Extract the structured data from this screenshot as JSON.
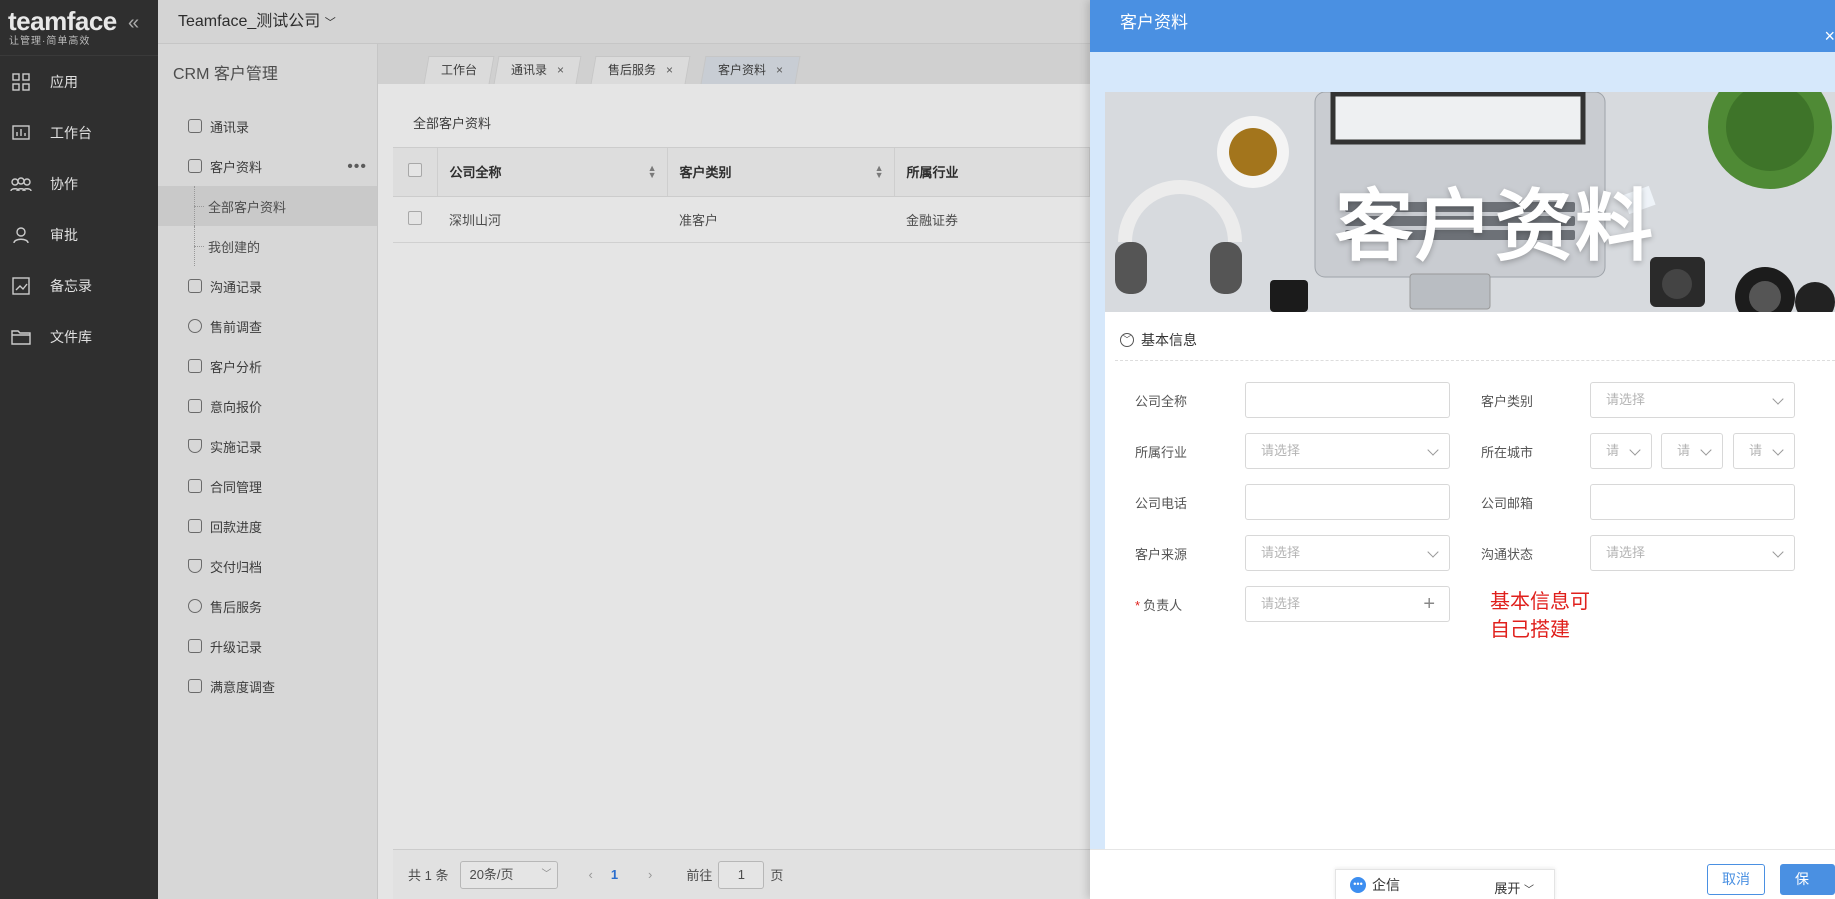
{
  "app": {
    "brand": "teamface",
    "slogan": "让管理·简单高效",
    "company": "Teamface_测试公司"
  },
  "nav": {
    "items": [
      {
        "label": "应用",
        "icon": "grid-icon"
      },
      {
        "label": "工作台",
        "icon": "chart-icon"
      },
      {
        "label": "协作",
        "icon": "people-icon"
      },
      {
        "label": "审批",
        "icon": "user-icon"
      },
      {
        "label": "备忘录",
        "icon": "memo-icon"
      },
      {
        "label": "文件库",
        "icon": "folder-icon"
      }
    ]
  },
  "crm": {
    "title": "CRM 客户管理",
    "items": [
      {
        "label": "通讯录"
      },
      {
        "label": "客户资料"
      },
      {
        "label": "全部客户资料"
      },
      {
        "label": "我创建的"
      },
      {
        "label": "沟通记录"
      },
      {
        "label": "售前调查"
      },
      {
        "label": "客户分析"
      },
      {
        "label": "意向报价"
      },
      {
        "label": "实施记录"
      },
      {
        "label": "合同管理"
      },
      {
        "label": "回款进度"
      },
      {
        "label": "交付归档"
      },
      {
        "label": "售后服务"
      },
      {
        "label": "升级记录"
      },
      {
        "label": "满意度调查"
      }
    ]
  },
  "tabs": [
    {
      "label": "工作台"
    },
    {
      "label": "通讯录"
    },
    {
      "label": "售后服务"
    },
    {
      "label": "客户资料"
    }
  ],
  "list": {
    "title": "全部客户资料",
    "columns": [
      "公司全称",
      "客户类别",
      "所属行业"
    ],
    "rows": [
      [
        "深圳山河",
        "准客户",
        "金融证券"
      ]
    ],
    "pager": {
      "total": "共 1 条",
      "size": "20条/页",
      "page": "1",
      "goto": "前往",
      "goto_value": "1",
      "unit": "页"
    }
  },
  "drawer": {
    "title": "客户资料",
    "close": "×",
    "banner_title": "客户资料",
    "section": "基本信息",
    "fields": {
      "company_name": "公司全称",
      "customer_type": "客户类别",
      "industry": "所属行业",
      "city": "所在城市",
      "phone": "公司电话",
      "email": "公司邮箱",
      "source": "客户来源",
      "status": "沟通状态",
      "owner": "负责人"
    },
    "placeholder": "请选择",
    "placeholder_short": "请",
    "note_line1": "基本信息可",
    "note_line2": "自己搭建",
    "qixin": "企信",
    "expand": "展开",
    "cancel": "取消",
    "save": "保存"
  }
}
